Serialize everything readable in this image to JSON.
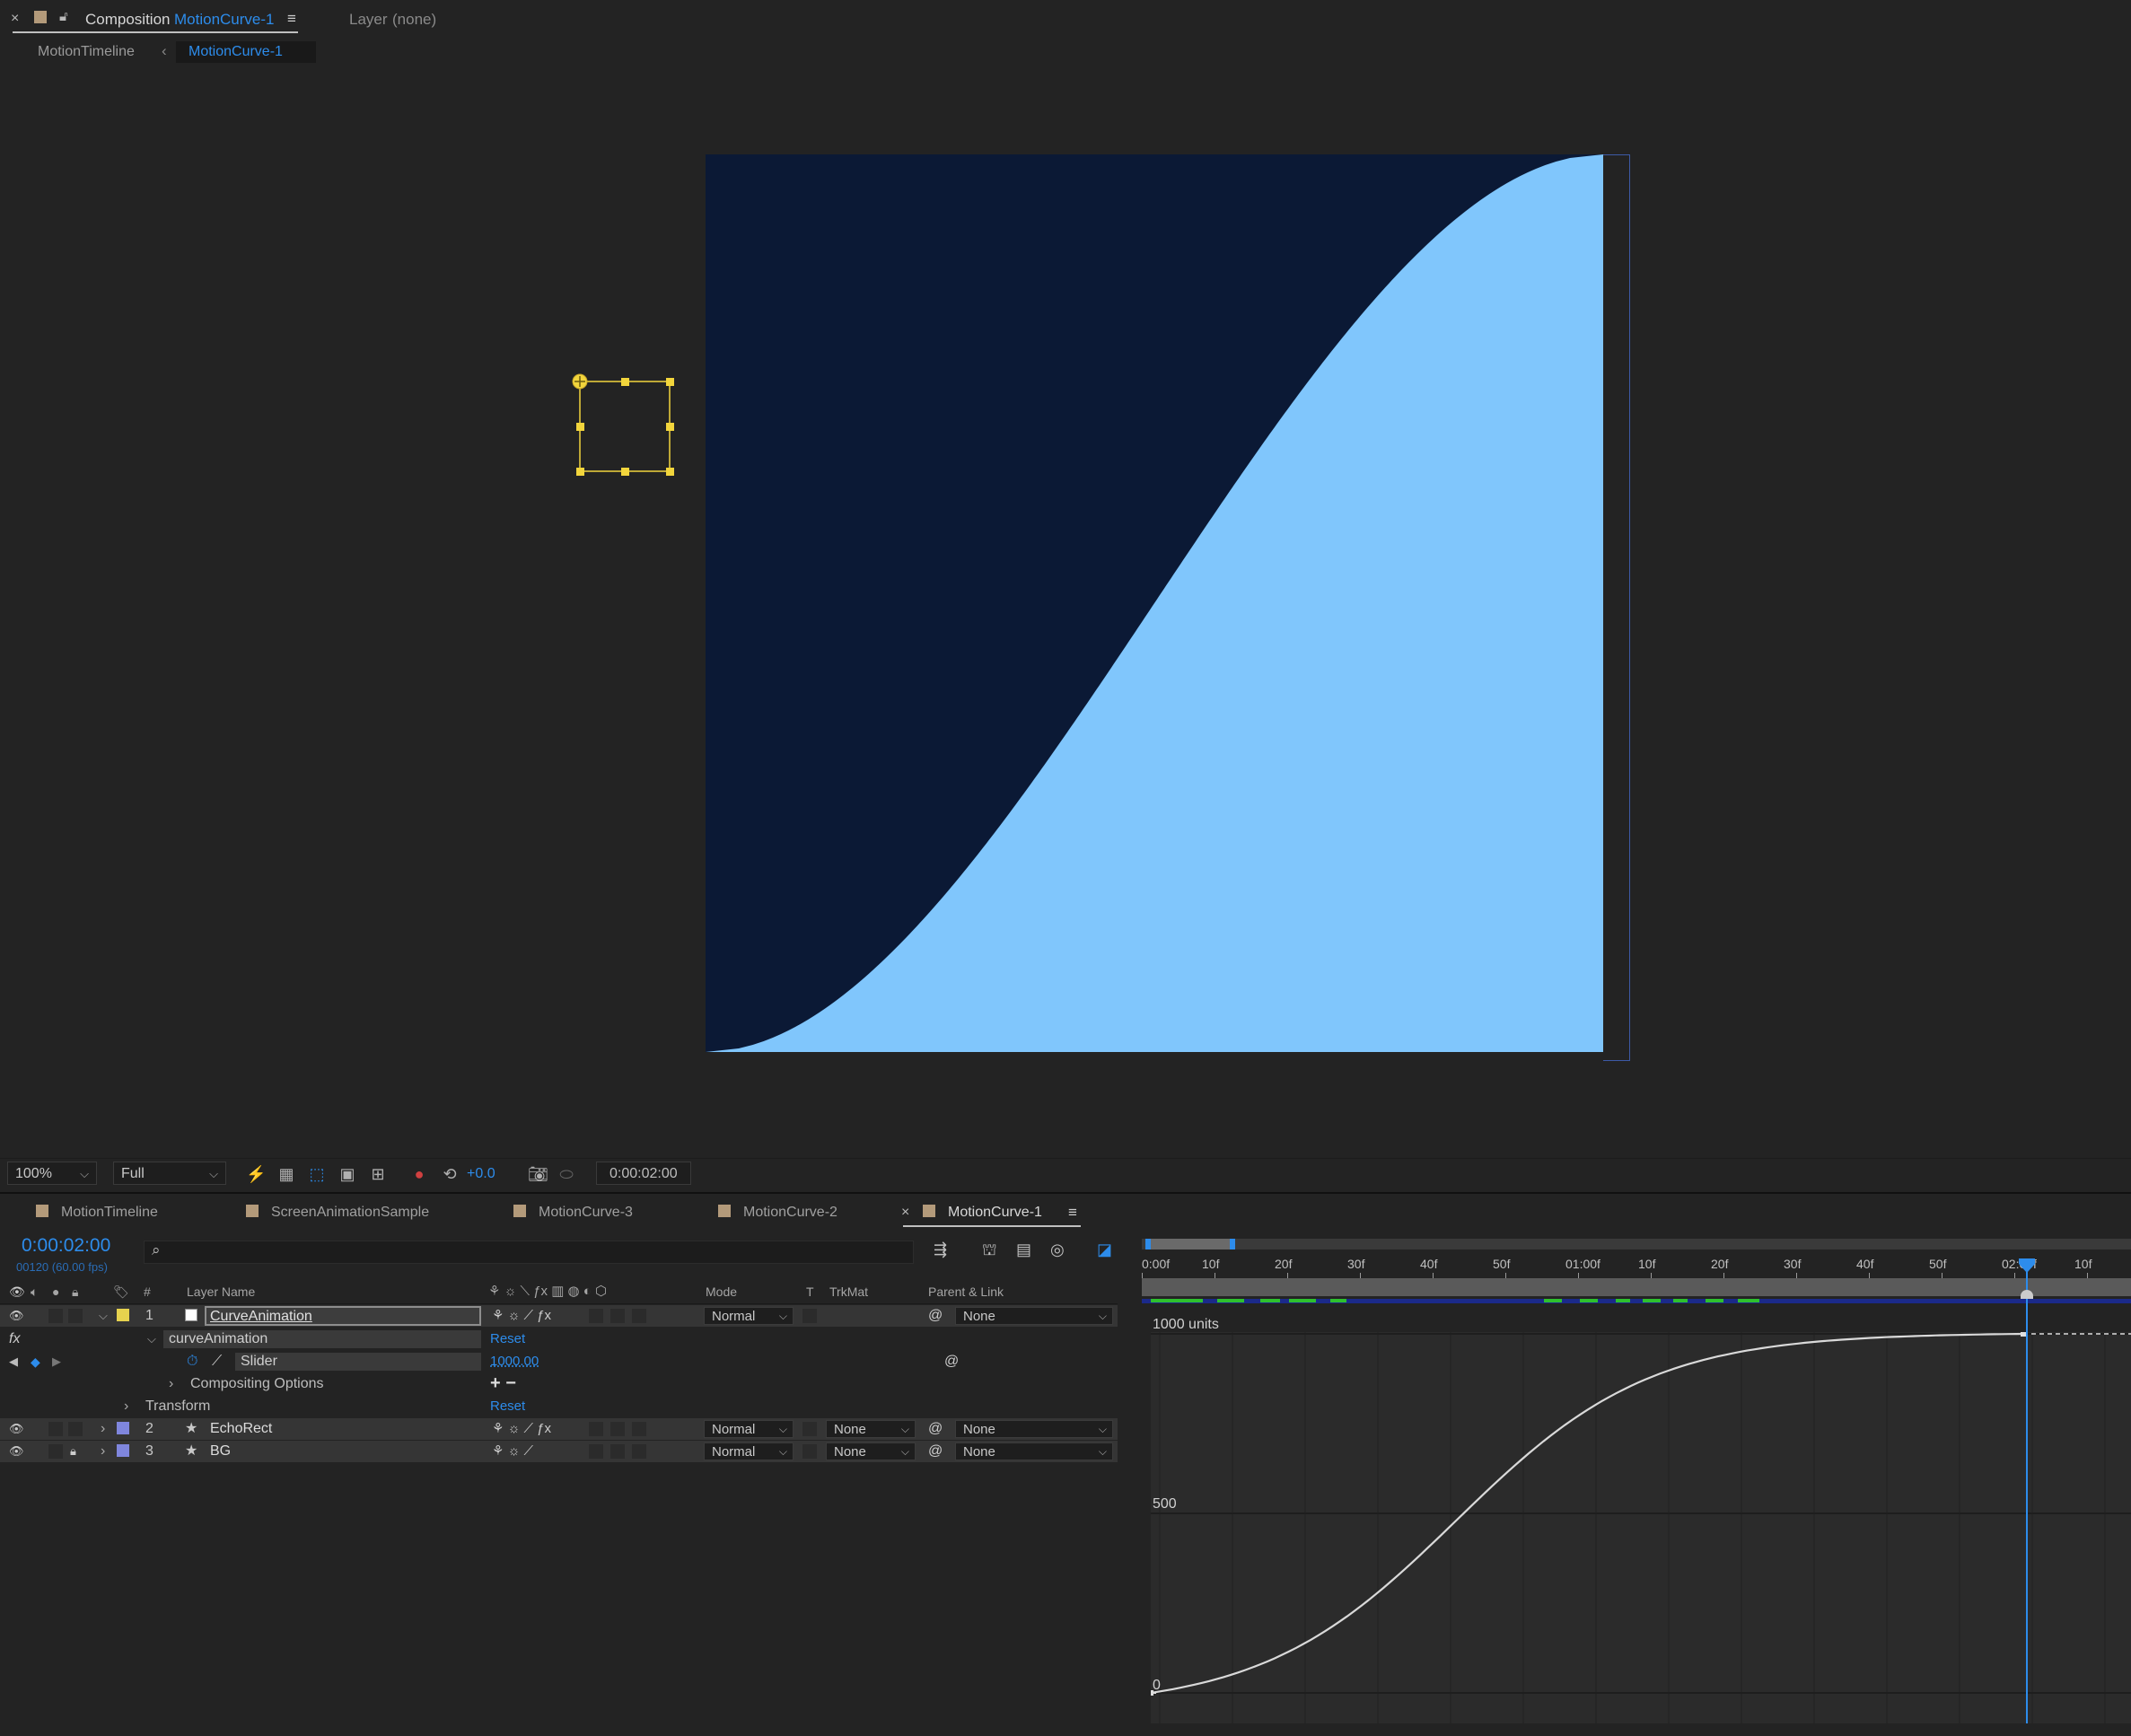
{
  "composition_panel": {
    "close": "×",
    "title": "Composition",
    "comp_name": "MotionCurve-1",
    "menu": "≡",
    "layer_label": "Layer",
    "layer_value": "(none)",
    "breadcrumb_parent": "MotionTimeline",
    "breadcrumb_sep": "‹",
    "breadcrumb_current": "MotionCurve-1"
  },
  "canvas": {
    "background": "#0b1935",
    "fill": "#80c6fc",
    "selection_color": "#f2d53c",
    "curve_type": "ease-in-out (smoothstep-like) area fill"
  },
  "viewer_toolbar": {
    "zoom": "100%",
    "resolution": "Full",
    "exposure": "+0.0",
    "timecode": "0:00:02:00",
    "icons": [
      "fast-preview-icon",
      "transparency-grid-icon",
      "mask-path-icon",
      "region-of-interest-icon",
      "grid-guides-icon",
      "color-channels-icon",
      "reset-exposure-icon",
      "snapshot-icon",
      "show-snapshot-icon"
    ]
  },
  "timeline_tabs": [
    {
      "label": "MotionTimeline",
      "active": false
    },
    {
      "label": "ScreenAnimationSample",
      "active": false
    },
    {
      "label": "MotionCurve-3",
      "active": false
    },
    {
      "label": "MotionCurve-2",
      "active": false
    },
    {
      "label": "MotionCurve-1",
      "active": true
    }
  ],
  "timeline": {
    "close": "×",
    "menu": "≡",
    "current_time": "0:00:02:00",
    "frame_info": "00120 (60.00 fps)",
    "search_icon": "⌕",
    "headers": {
      "number": "#",
      "layer_name": "Layer Name",
      "mode": "Mode",
      "t": "T",
      "trkmat": "TrkMat",
      "parent": "Parent & Link"
    },
    "layers": [
      {
        "num": "1",
        "name": "CurveAnimation",
        "mode": "Normal",
        "trkmat": "",
        "parent": "None",
        "label_color": "#e6d24e",
        "selected": true
      },
      {
        "num": "2",
        "name": "EchoRect",
        "mode": "Normal",
        "trkmat": "None",
        "parent": "None",
        "label_color": "#7f86dd",
        "selected": false
      },
      {
        "num": "3",
        "name": "BG",
        "mode": "Normal",
        "trkmat": "None",
        "parent": "None",
        "label_color": "#7f86dd",
        "selected": false
      }
    ],
    "effect": {
      "fx_label": "fx",
      "name": "curveAnimation",
      "reset": "Reset",
      "property": "Slider",
      "value": "1000.00",
      "compositing_options": "Compositing Options",
      "plus_minus": "+ −"
    },
    "transform": {
      "label": "Transform",
      "reset": "Reset"
    }
  },
  "graph_editor": {
    "ruler_labels": [
      "0:00f",
      "10f",
      "20f",
      "30f",
      "40f",
      "50f",
      "01:00f",
      "10f",
      "20f",
      "30f",
      "40f",
      "50f",
      "02:00f",
      "10f"
    ],
    "y_labels": {
      "top": "1000 units",
      "mid": "500",
      "bottom": "0"
    },
    "playhead_time": "02:00f",
    "curve_color": "#d9d9d9",
    "playhead_color": "#2d8ceb",
    "keyframes": [
      {
        "time_s": 0,
        "value": 0
      },
      {
        "time_s": 2,
        "value": 1000
      }
    ],
    "y_range": [
      0,
      1000
    ]
  }
}
